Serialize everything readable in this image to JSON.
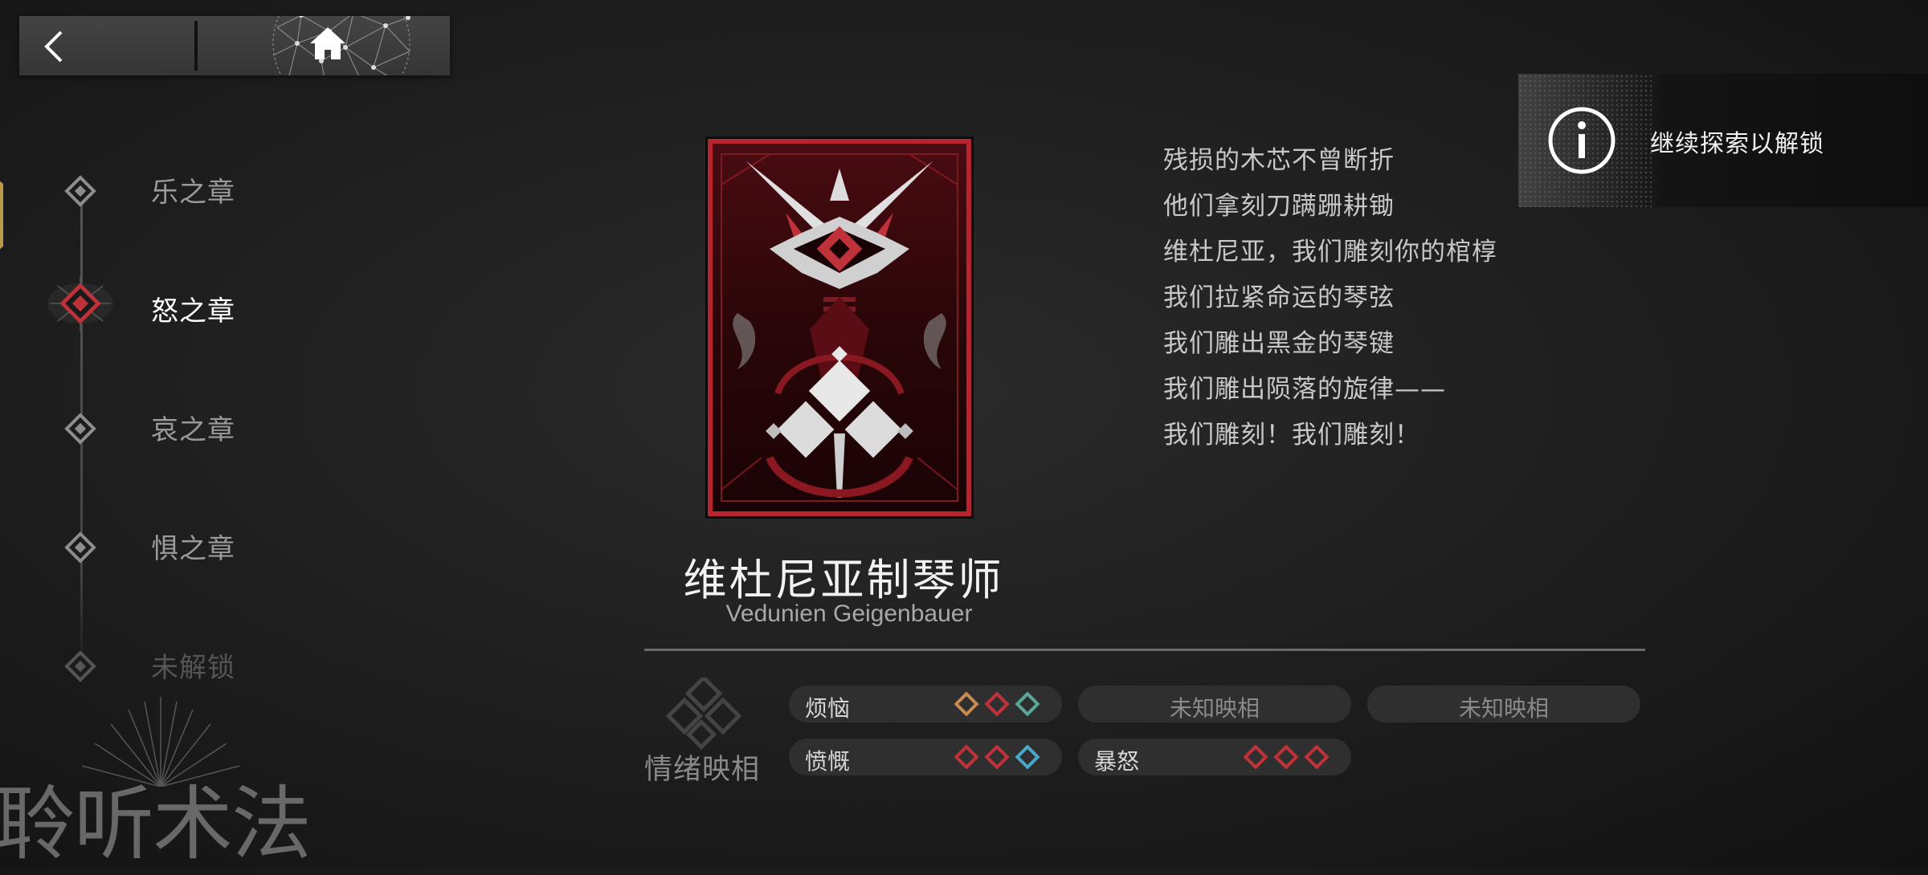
{
  "nav": {
    "back_icon": "chevron-left-icon",
    "home_icon": "home-icon"
  },
  "chapters": [
    {
      "label": "乐之章",
      "state": "normal"
    },
    {
      "label": "怒之章",
      "state": "active"
    },
    {
      "label": "哀之章",
      "state": "normal"
    },
    {
      "label": "惧之章",
      "state": "normal"
    },
    {
      "label": "未解锁",
      "state": "locked"
    }
  ],
  "watermark": "聆听术法",
  "character": {
    "name_cn": "维杜尼亚制琴师",
    "name_en": "Vedunien Geigenbauer"
  },
  "poem": [
    "残损的木芯不曾断折",
    "他们拿刻刀蹒跚耕锄",
    "维杜尼亚，我们雕刻你的棺椁",
    "我们拉紧命运的琴弦",
    "我们雕出黑金的琴键",
    "我们雕出陨落的旋律——",
    "我们雕刻！我们雕刻！"
  ],
  "hint": {
    "text": "继续探索以解锁",
    "icon": "info-icon"
  },
  "emotion": {
    "title": "情绪映相",
    "items": [
      {
        "label": "烦恼",
        "gems": [
          "#c98a52",
          "#c0323a",
          "#5aa898"
        ]
      },
      {
        "label": "未知映相",
        "unknown": true
      },
      {
        "label": "未知映相",
        "unknown": true
      },
      {
        "label": "愤慨",
        "gems": [
          "#c0323a",
          "#c0323a",
          "#4aa8c8"
        ]
      },
      {
        "label": "暴怒",
        "gems": [
          "#c0323a",
          "#c0323a",
          "#c0323a"
        ]
      }
    ]
  },
  "colors": {
    "accent_red": "#c0323a",
    "gold": "#b89a4a"
  }
}
